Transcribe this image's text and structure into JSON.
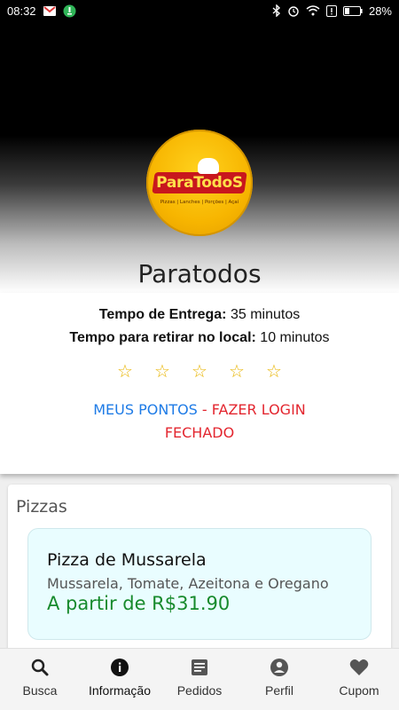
{
  "status_bar": {
    "time": "08:32",
    "battery": "28%",
    "icons": [
      "gmail-icon",
      "download-icon",
      "bluetooth-icon",
      "alarm-icon",
      "wifi-icon",
      "alert-icon",
      "battery-icon"
    ]
  },
  "store": {
    "logo_text": "ParaTodoS",
    "logo_subtitle": "Pizzas | Lanches | Porções | Açaí",
    "name": "Paratodos",
    "delivery_label": "Tempo de Entrega:",
    "delivery_value": " 35 minutos",
    "pickup_label": "Tempo para retirar no local:",
    "pickup_value": " 10 minutos",
    "rating_stars": 5,
    "star_glyph": "☆",
    "points_link": "MEUS PONTOS",
    "login_link": " - FAZER LOGIN",
    "status": "FECHADO"
  },
  "menu": {
    "section_title": "Pizzas",
    "products": [
      {
        "name": "Pizza de Mussarela",
        "description": "Mussarela, Tomate, Azeitona e Oregano",
        "price": "A partir de R$31.90"
      }
    ]
  },
  "bottom_nav": {
    "items": [
      {
        "label": "Busca",
        "icon": "search-icon"
      },
      {
        "label": "Informação",
        "icon": "info-icon"
      },
      {
        "label": "Pedidos",
        "icon": "orders-icon"
      },
      {
        "label": "Perfil",
        "icon": "profile-icon"
      },
      {
        "label": "Cupom",
        "icon": "heart-icon"
      }
    ]
  },
  "colors": {
    "link_blue": "#1e7be6",
    "alert_red": "#e3262f",
    "price_green": "#178a2c",
    "star_gold": "#e8b400"
  }
}
